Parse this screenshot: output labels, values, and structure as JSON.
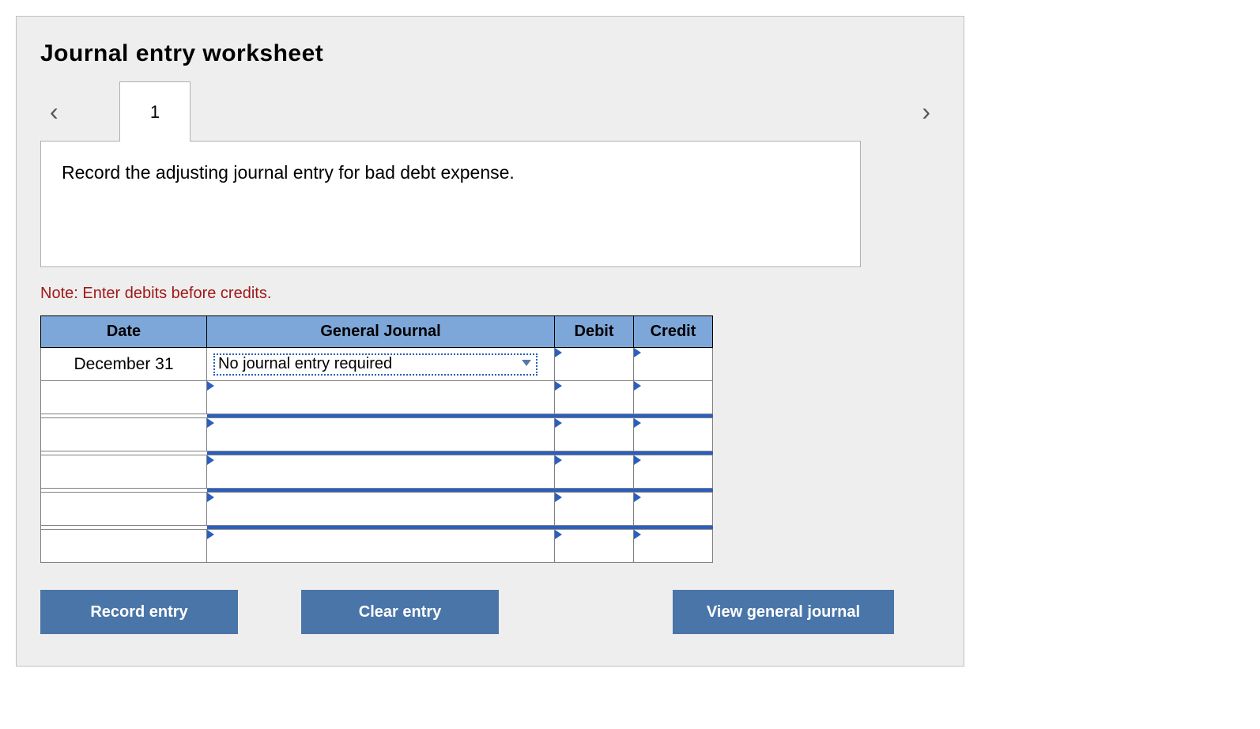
{
  "title": "Journal entry worksheet",
  "nav": {
    "prev_glyph": "‹",
    "next_glyph": "›",
    "tab_label": "1"
  },
  "instruction": "Record the adjusting journal entry for bad debt expense.",
  "note": "Note: Enter debits before credits.",
  "table": {
    "headers": {
      "date": "Date",
      "gj": "General Journal",
      "debit": "Debit",
      "credit": "Credit"
    },
    "rows": [
      {
        "date": "December 31",
        "account": "No journal entry required",
        "debit": "",
        "credit": ""
      },
      {
        "date": "",
        "account": "",
        "debit": "",
        "credit": ""
      },
      {
        "date": "",
        "account": "",
        "debit": "",
        "credit": ""
      },
      {
        "date": "",
        "account": "",
        "debit": "",
        "credit": ""
      },
      {
        "date": "",
        "account": "",
        "debit": "",
        "credit": ""
      },
      {
        "date": "",
        "account": "",
        "debit": "",
        "credit": ""
      }
    ]
  },
  "buttons": {
    "record": "Record entry",
    "clear": "Clear entry",
    "view": "View general journal"
  }
}
